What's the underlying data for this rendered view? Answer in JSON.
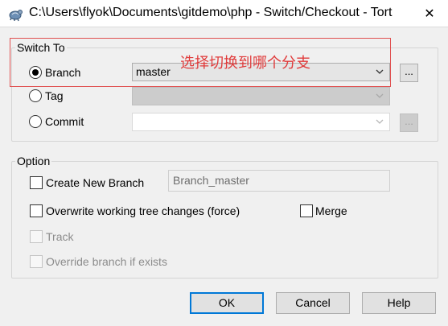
{
  "window": {
    "title": "C:\\Users\\flyok\\Documents\\gitdemo\\php - Switch/Checkout - Tort",
    "close_glyph": "✕",
    "icon": "tortoise-icon"
  },
  "switch_to": {
    "label": "Switch To",
    "branch_label": "Branch",
    "branch_value": "master",
    "tag_label": "Tag",
    "commit_label": "Commit",
    "browse_label": "..."
  },
  "annotation": {
    "text": "选择切换到哪个分支",
    "color": "#e03a3a"
  },
  "option": {
    "label": "Option",
    "create_new_branch": "Create New Branch",
    "new_branch_name": "Branch_master",
    "overwrite": "Overwrite working tree changes (force)",
    "merge": "Merge",
    "track": "Track",
    "override": "Override branch if exists"
  },
  "buttons": {
    "ok": "OK",
    "cancel": "Cancel",
    "help": "Help"
  },
  "colors": {
    "accent": "#0078d7",
    "background": "#f0f0f0"
  }
}
